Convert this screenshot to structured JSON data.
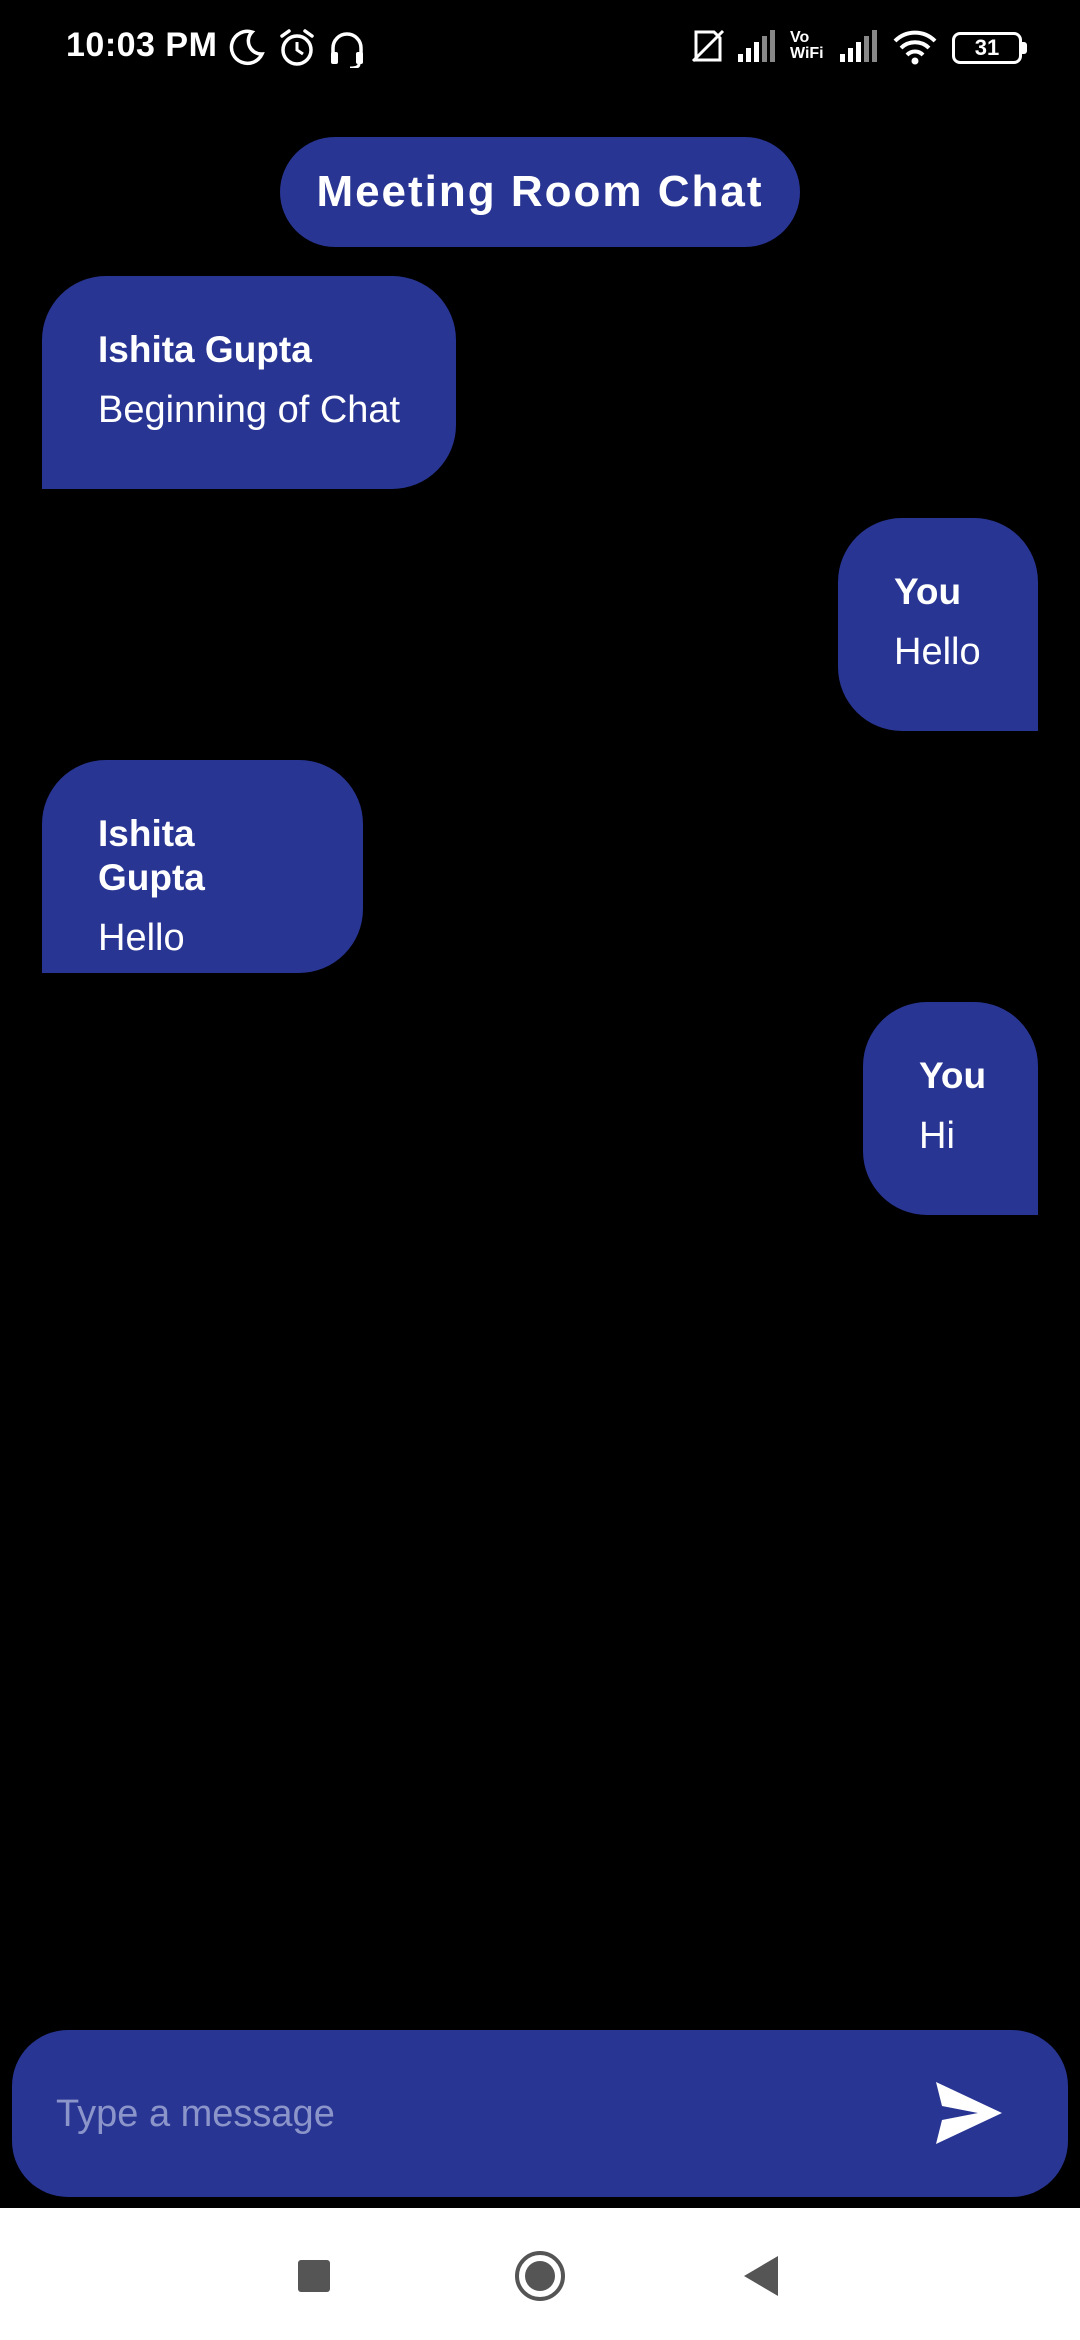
{
  "status_bar": {
    "time": "10:03 PM",
    "icons": [
      "moon-icon",
      "alarm-icon",
      "headset-icon",
      "no-sim-icon",
      "signal-icon",
      "vowifi-icon",
      "signal-icon",
      "wifi-icon",
      "battery-icon"
    ],
    "vowifi_top": "Vo",
    "vowifi_bottom": "WiFi",
    "battery_level": "31"
  },
  "header": {
    "title": "Meeting Room Chat"
  },
  "messages": [
    {
      "sender": "Ishita Gupta",
      "text": "Beginning of Chat",
      "side": "left"
    },
    {
      "sender": "You",
      "text": "Hello",
      "side": "right"
    },
    {
      "sender": "Ishita Gupta",
      "text": "Hello",
      "side": "left"
    },
    {
      "sender": "You",
      "text": "Hi",
      "side": "right"
    }
  ],
  "composer": {
    "placeholder": "Type a message",
    "value": "",
    "send_icon": "send-icon"
  },
  "nav_bar": {
    "icons": [
      "recents-icon",
      "home-icon",
      "back-icon"
    ]
  },
  "colors": {
    "background": "#000000",
    "accent": "#283593",
    "text": "#ffffff",
    "placeholder": "#8c95c9"
  }
}
